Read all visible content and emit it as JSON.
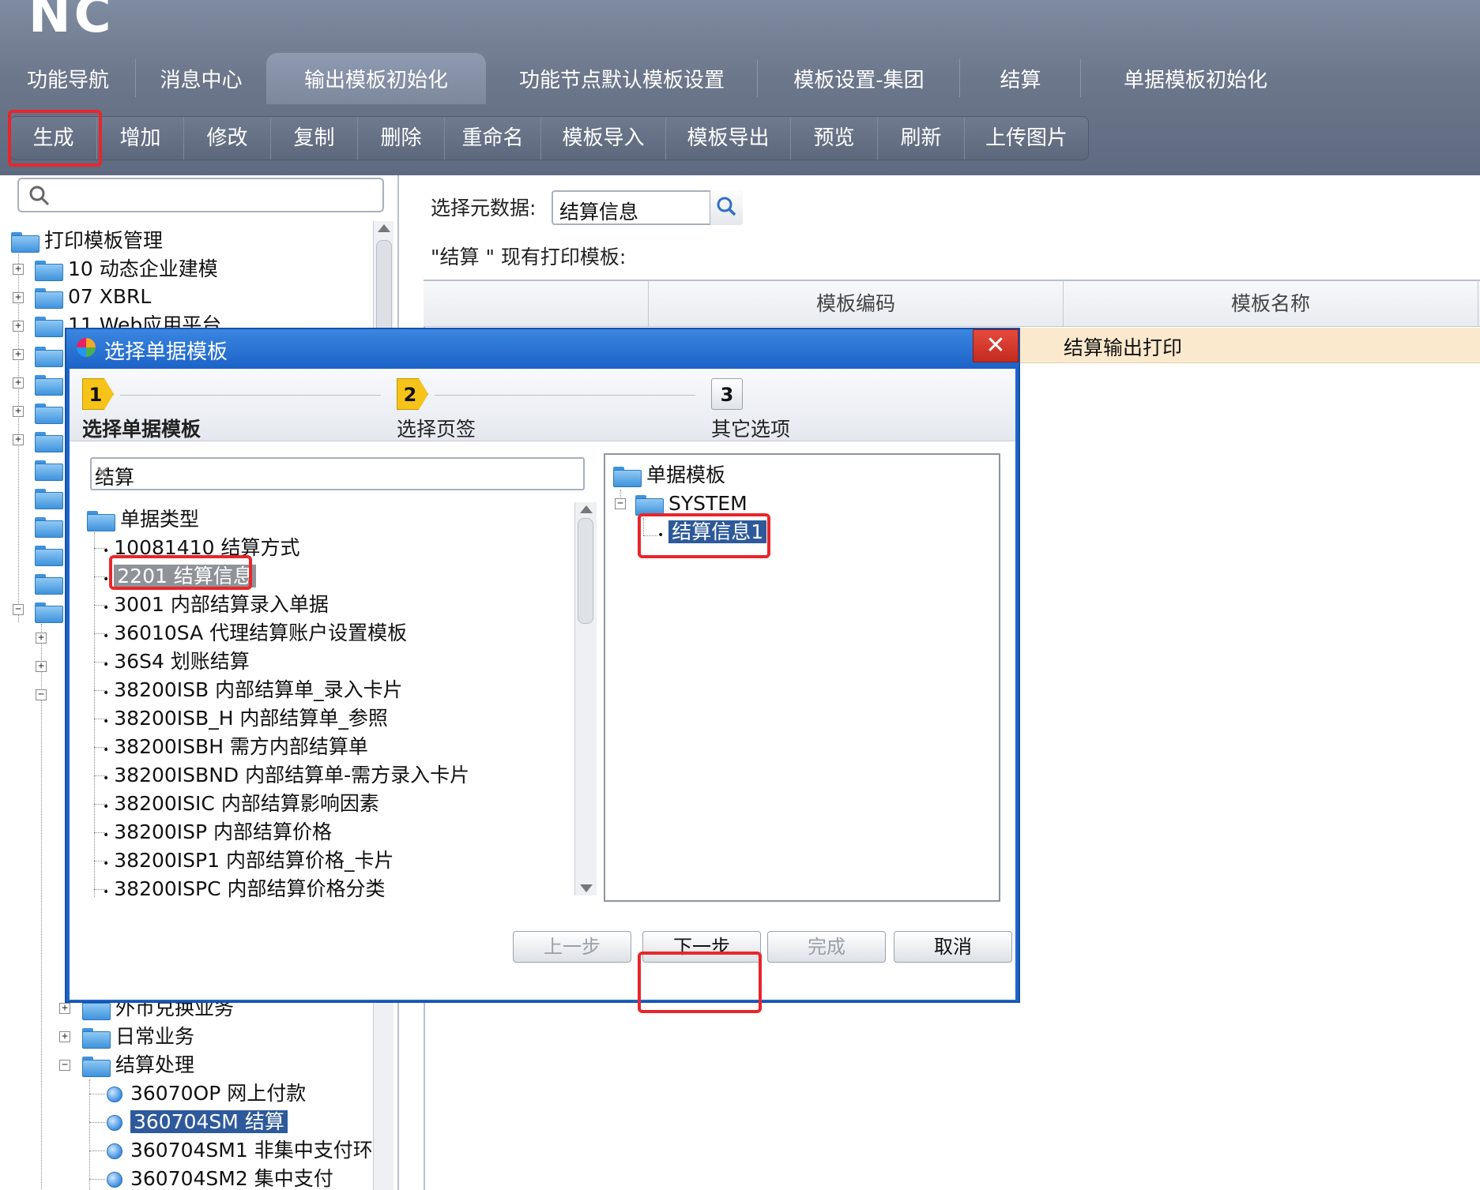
{
  "app": {
    "logo": "NC"
  },
  "tabs": [
    {
      "label": "功能导航",
      "active": false
    },
    {
      "label": "消息中心",
      "active": false
    },
    {
      "label": "输出模板初始化",
      "active": true
    },
    {
      "label": "功能节点默认模板设置",
      "active": false
    },
    {
      "label": "模板设置-集团",
      "active": false
    },
    {
      "label": "结算",
      "active": false
    },
    {
      "label": "单据模板初始化",
      "active": false
    }
  ],
  "toolbar": [
    "生成",
    "增加",
    "修改",
    "复制",
    "删除",
    "重命名",
    "模板导入",
    "模板导出",
    "预览",
    "刷新",
    "上传图片"
  ],
  "left_tree": {
    "root": "打印模板管理",
    "items": [
      "10 动态企业建模",
      "07 XBRL",
      "11 Web应用平台"
    ],
    "lower": [
      {
        "label": "外币兑换业务",
        "expanded": false
      },
      {
        "label": "日常业务",
        "expanded": false
      },
      {
        "label": "结算处理",
        "expanded": true
      }
    ],
    "nodes": [
      {
        "label": "36070OP 网上付款",
        "selected": false
      },
      {
        "label": "360704SM 结算",
        "selected": true
      },
      {
        "label": "360704SM1 非集中支付环",
        "selected": false
      },
      {
        "label": "360704SM2 集中支付",
        "selected": false
      }
    ]
  },
  "right": {
    "meta_label": "选择元数据:",
    "meta_value": "结算信息",
    "templates_label": "\"结算  \" 现有打印模板:",
    "columns": [
      "模板编码",
      "模板名称"
    ],
    "rows": [
      {
        "code": "",
        "name": "结算输出打印"
      }
    ]
  },
  "dialog": {
    "title": "选择单据模板",
    "close": "✕",
    "steps": [
      {
        "num": "1",
        "label": "选择单据模板",
        "current": true
      },
      {
        "num": "2",
        "label": "选择页签",
        "current": false
      },
      {
        "num": "3",
        "label": "其它选项",
        "current": false
      }
    ],
    "search_value": "结算",
    "search_clear": "✕",
    "left_tree_root": "单据类型",
    "left_items": [
      "10081410 结算方式",
      "2201 结算信息",
      "3001 内部结算录入单据",
      "36010SA 代理结算账户设置模板",
      "36S4 划账结算",
      "38200ISB 内部结算单_录入卡片",
      "38200ISB_H 内部结算单_参照",
      "38200ISBH 需方内部结算单",
      "38200ISBND 内部结算单-需方录入卡片",
      "38200ISIC 内部结算影响因素",
      "38200ISP 内部结算价格",
      "38200ISP1 内部结算价格_卡片",
      "38200ISPC 内部结算价格分类"
    ],
    "right_tree_root": "单据模板",
    "right_folder": "SYSTEM",
    "right_leaf": "结算信息1",
    "buttons": {
      "prev": "上一步",
      "next": "下一步",
      "finish": "完成",
      "cancel": "取消"
    }
  },
  "colors": {
    "highlight_red": "#e8262a",
    "selection_blue": "#2e5a9c",
    "row_highlight": "#fbe9cd",
    "dialog_frame": "#1d64c9"
  }
}
